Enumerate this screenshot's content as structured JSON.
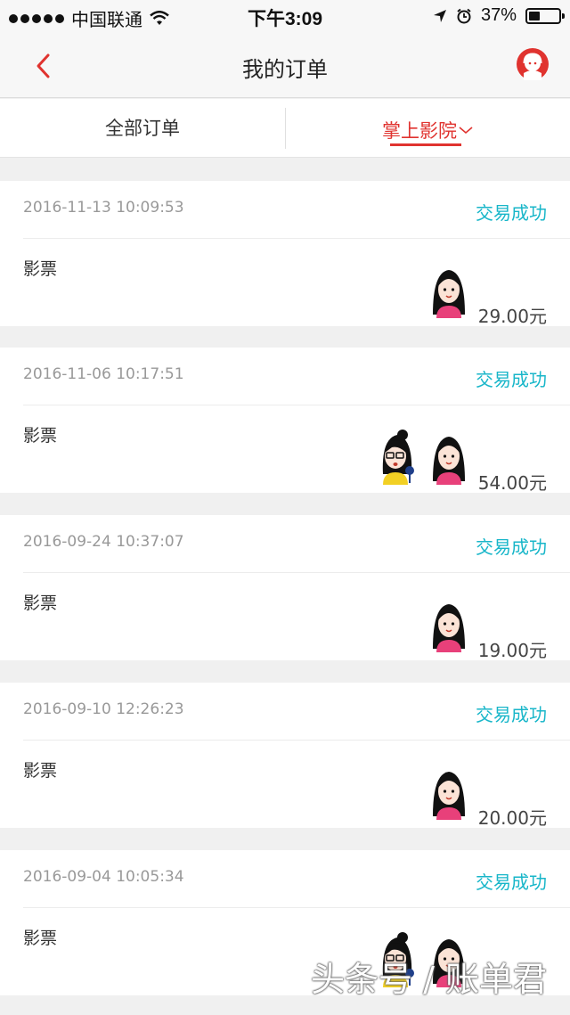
{
  "status_bar": {
    "carrier": "中国联通",
    "time": "下午3:09",
    "battery": "37%",
    "battery_level": 0.37,
    "icons": [
      "signal-dots-icon",
      "wifi-icon",
      "location-arrow-icon",
      "alarm-icon",
      "battery-icon"
    ]
  },
  "nav": {
    "title": "我的订单",
    "back_icon": "back-chevron-icon",
    "support_icon": "customer-service-icon"
  },
  "tabs": {
    "all": "全部订单",
    "cinema": "掌上影院"
  },
  "colors": {
    "accent": "#e0332f",
    "status": "#18b6c9"
  },
  "orders": [
    {
      "date": "2016-11-13 10:09:53",
      "status": "交易成功",
      "type": "影票",
      "price": "29.00元",
      "avatars": [
        "girl-avatar-icon"
      ]
    },
    {
      "date": "2016-11-06 10:17:51",
      "status": "交易成功",
      "type": "影票",
      "price": "54.00元",
      "avatars": [
        "girl-avatar-icon",
        "glasses-girl-avatar-icon"
      ]
    },
    {
      "date": "2016-09-24 10:37:07",
      "status": "交易成功",
      "type": "影票",
      "price": "19.00元",
      "avatars": [
        "girl-avatar-icon"
      ]
    },
    {
      "date": "2016-09-10 12:26:23",
      "status": "交易成功",
      "type": "影票",
      "price": "20.00元",
      "avatars": [
        "girl-avatar-icon"
      ]
    },
    {
      "date": "2016-09-04 10:05:34",
      "status": "交易成功",
      "type": "影票",
      "price": "",
      "avatars": [
        "girl-avatar-icon",
        "glasses-girl-avatar-icon"
      ]
    }
  ],
  "watermark": "头条号 / 账单君"
}
